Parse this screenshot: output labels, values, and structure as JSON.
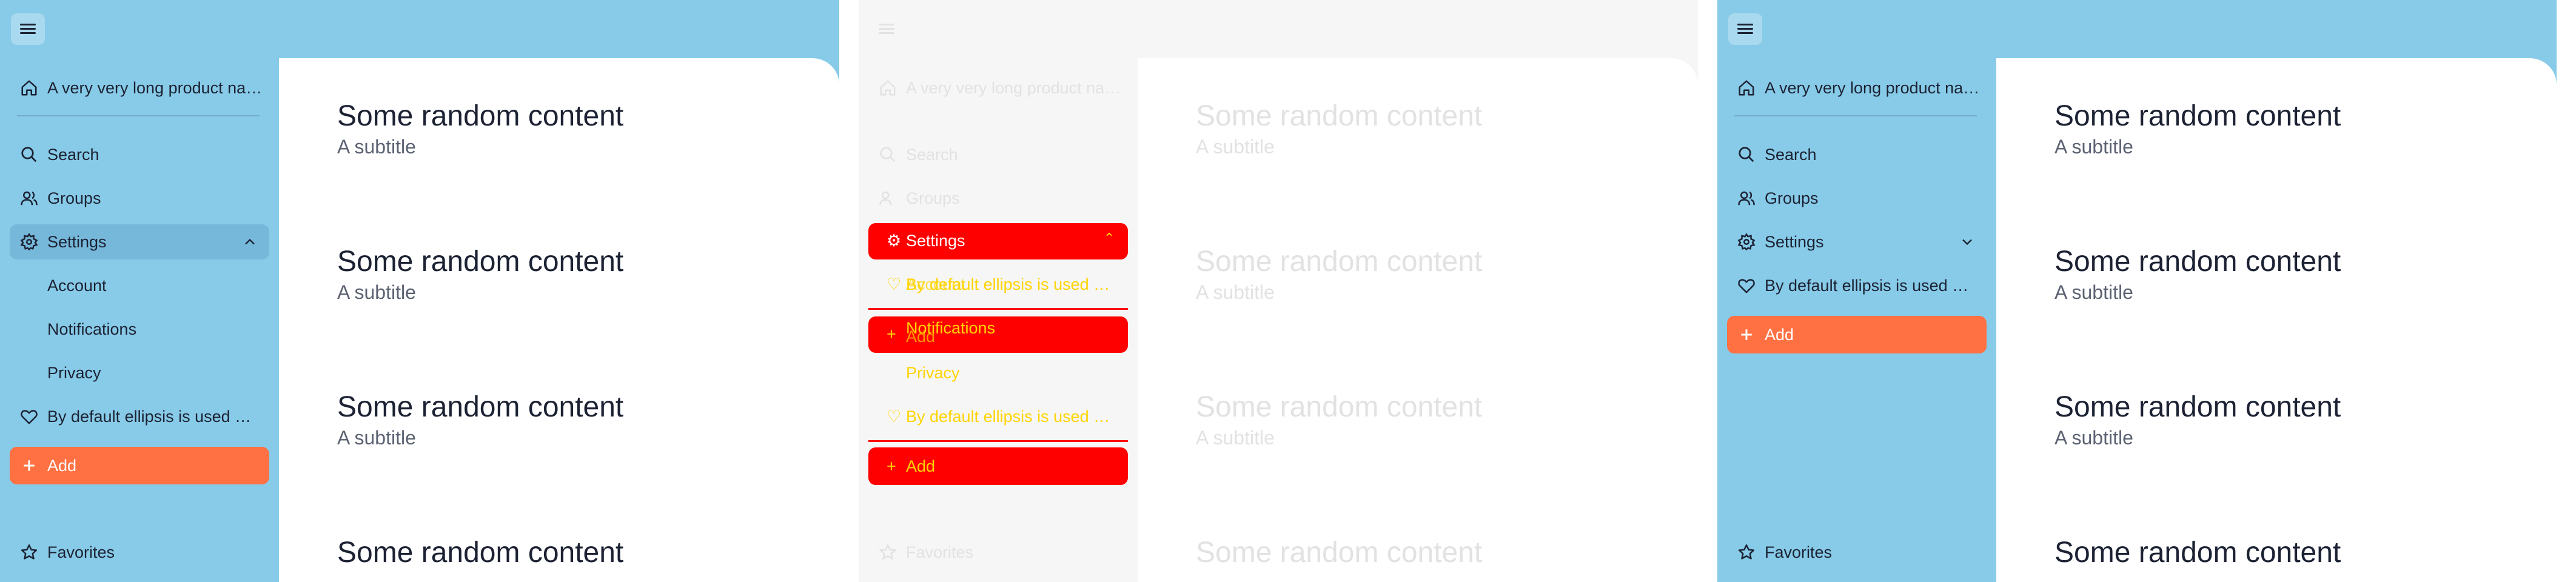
{
  "app": {
    "product_name": "A very very long product name",
    "menu_icon": "hamburger-icon"
  },
  "nav": {
    "search": "Search",
    "groups": "Groups",
    "settings": "Settings",
    "account": "Account",
    "notifications": "Notifications",
    "privacy": "Privacy",
    "long_item": "By default ellipsis is used but you can",
    "add": "Add",
    "favorites": "Favorites"
  },
  "content": {
    "blocks": [
      {
        "title": "Some random content",
        "subtitle": "A subtitle"
      },
      {
        "title": "Some random content",
        "subtitle": "A subtitle"
      },
      {
        "title": "Some random content",
        "subtitle": "A subtitle"
      },
      {
        "title": "Some random content",
        "subtitle": ""
      }
    ]
  },
  "colors": {
    "sidebar_bg": "#87cbe8",
    "accent": "#ff7143",
    "overlay_red": "#ff0000",
    "overlay_text": "#ffd400"
  }
}
